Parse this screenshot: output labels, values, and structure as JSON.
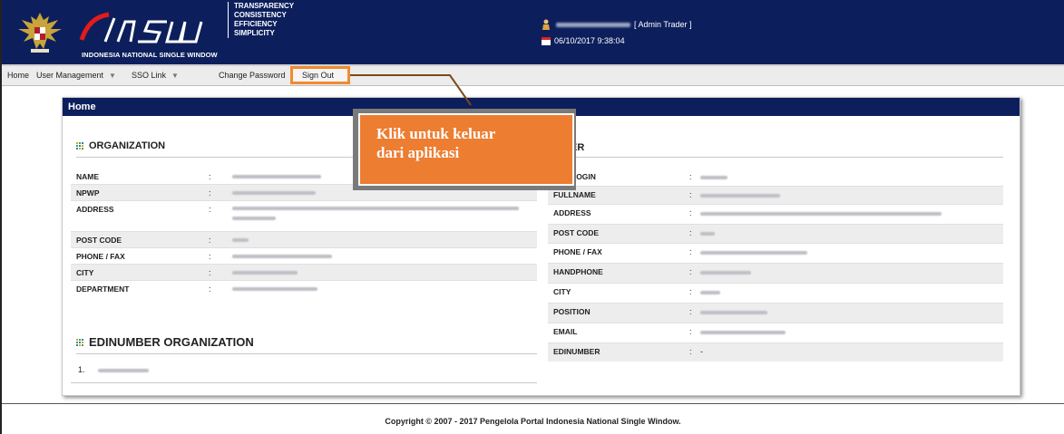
{
  "header": {
    "logo_text": "INSW",
    "logo_subtitle": "INDONESIA NATIONAL SINGLE WINDOW",
    "tagline": [
      "TRANSPARENCY",
      "CONSISTENCY",
      "EFFICIENCY",
      "SIMPLICITY"
    ],
    "user_role": "[ Admin Trader ]",
    "datetime": "06/10/2017 9:38:04"
  },
  "menu": {
    "home": "Home",
    "user_management": "User Management",
    "sso_link": "SSO Link",
    "change_password": "Change Password",
    "sign_out": "Sign Out"
  },
  "panel": {
    "title": "Home",
    "organization": {
      "title": "ORGANIZATION",
      "fields": [
        {
          "label": "NAME"
        },
        {
          "label": "NPWP"
        },
        {
          "label": "ADDRESS"
        },
        {
          "label": "POST CODE"
        },
        {
          "label": "PHONE / FAX"
        },
        {
          "label": "CITY"
        },
        {
          "label": "DEPARTMENT"
        }
      ]
    },
    "edinumber": {
      "title": "EDINUMBER ORGANIZATION",
      "items": [
        {
          "index": "1."
        }
      ]
    },
    "user": {
      "title_partial": "ER",
      "fields": [
        {
          "label": "LOGIN"
        },
        {
          "label": "FULLNAME"
        },
        {
          "label": "ADDRESS"
        },
        {
          "label": "POST CODE"
        },
        {
          "label": "PHONE / FAX"
        },
        {
          "label": "HANDPHONE"
        },
        {
          "label": "CITY"
        },
        {
          "label": "POSITION"
        },
        {
          "label": "EMAIL"
        },
        {
          "label": "EDINUMBER",
          "value": "-"
        }
      ]
    }
  },
  "callout": {
    "text_line1": "Klik untuk keluar",
    "text_line2": "dari aplikasi"
  },
  "footer": {
    "copyright": "Copyright © 2007 - 2017 Pengelola Portal Indonesia National Single Window."
  },
  "colors": {
    "header_bg": "#0c1f5c",
    "callout": "#ed7d31",
    "highlight_border": "#f28a2f"
  }
}
